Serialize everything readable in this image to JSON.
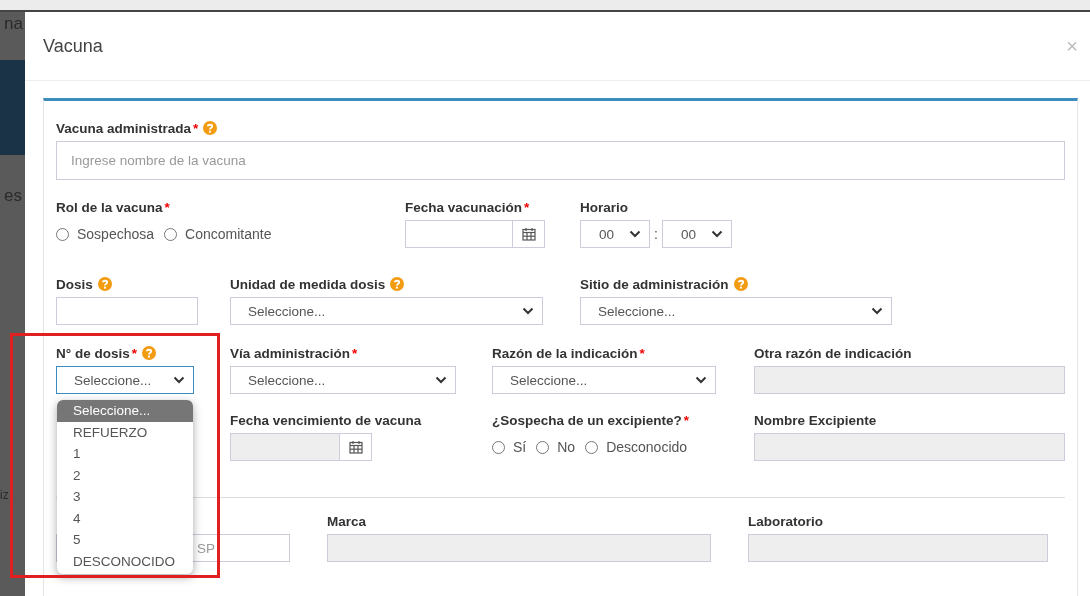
{
  "background_fragments": [
    "na",
    "es",
    "iz"
  ],
  "modal": {
    "title": "Vacuna",
    "close": "×"
  },
  "rows": [
    [
      {
        "kind": "text",
        "label": "Vacuna administrada",
        "mark": "*",
        "help": true,
        "placeholder": "Ingrese nombre de la vacuna"
      }
    ],
    [
      {
        "kind": "radios",
        "label": "Rol de la vacuna",
        "mark": "*",
        "options": [
          {
            "label": "Sospechosa",
            "selected": false
          },
          {
            "label": "Concomitante",
            "selected": false
          }
        ]
      },
      {
        "kind": "date",
        "label": "Fecha vacunación",
        "mark": "*",
        "disabled": false
      },
      {
        "kind": "time",
        "label": "Horario",
        "hour": "00",
        "separator": ":",
        "minute": "00"
      }
    ],
    [
      {
        "kind": "text",
        "label": "Dosis",
        "help": true
      },
      {
        "kind": "select",
        "label": "Unidad de medida dosis",
        "help": true,
        "value": "Seleccione..."
      },
      {
        "kind": "select",
        "label": "Sitio de administración",
        "help": true,
        "value": "Seleccione..."
      }
    ],
    [
      {
        "kind": "select",
        "label": "N° de dosis",
        "mark": "*",
        "help": true,
        "value": "Seleccione...",
        "focused": true,
        "expanded": true,
        "options": [
          {
            "label": "Seleccione...",
            "selected": true
          },
          {
            "label": "REFUERZO",
            "selected": false
          },
          {
            "label": "1",
            "selected": false
          },
          {
            "label": "2",
            "selected": false
          },
          {
            "label": "3",
            "selected": false
          },
          {
            "label": "4",
            "selected": false
          },
          {
            "label": "5",
            "selected": false
          },
          {
            "label": "DESCONOCIDO",
            "selected": false
          }
        ]
      },
      {
        "kind": "select",
        "label": "Vía administración",
        "mark": "*",
        "value": "Seleccione..."
      },
      {
        "kind": "select",
        "label": "Razón de la indicación",
        "mark": "*",
        "value": "Seleccione..."
      },
      {
        "kind": "text",
        "label": "Otra razón de indicación",
        "disabled": true
      }
    ],
    [
      {
        "kind": "date",
        "label": "Fecha vencimiento de vacuna",
        "disabled": true
      },
      {
        "kind": "radios",
        "label": "¿Sospecha de un excipiente?",
        "mark": "*",
        "options": [
          {
            "label": "Sí",
            "selected": false
          },
          {
            "label": "No",
            "selected": false
          },
          {
            "label": "Desconocido",
            "selected": false
          }
        ]
      },
      {
        "kind": "text",
        "label": "Nombre Excipiente",
        "disabled": true
      }
    ],
    [
      {
        "kind": "text",
        "placeholder": "SP"
      },
      {
        "kind": "text",
        "label": "Marca",
        "disabled": true
      },
      {
        "kind": "text",
        "label": "Laboratorio",
        "disabled": true
      }
    ]
  ],
  "annotation": {
    "kind": "frame",
    "color": "#e02020"
  }
}
